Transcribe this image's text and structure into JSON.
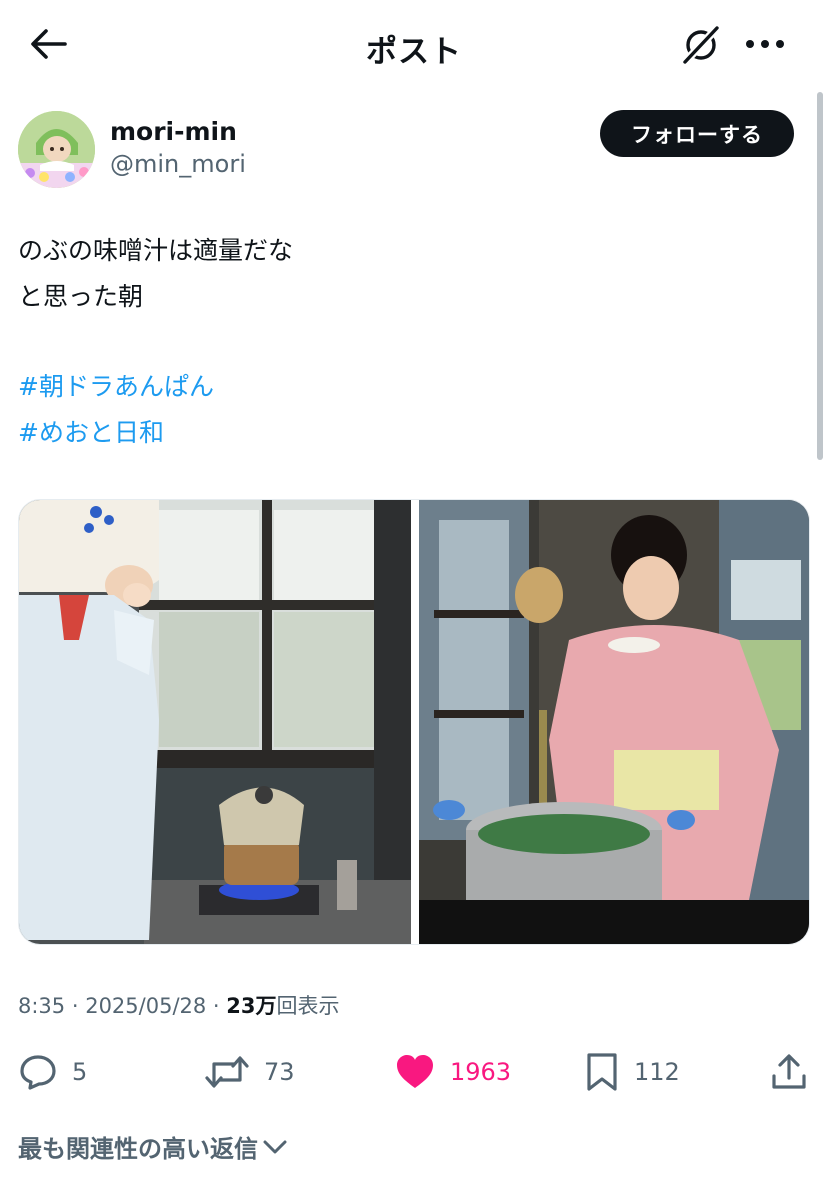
{
  "header": {
    "title": "ポスト"
  },
  "author": {
    "display_name": "mori-min",
    "handle": "@min_mori",
    "follow_label": "フォローする"
  },
  "tweet": {
    "lines": [
      "のぶの味噌汁は適量だな",
      "と思った朝"
    ],
    "hashtags": [
      "#朝ドラあんぱん",
      "#めおと日和"
    ]
  },
  "media": [
    {
      "icon": "photo-woman-drinking-by-stove"
    },
    {
      "icon": "photo-woman-kimono-with-pot"
    }
  ],
  "meta": {
    "time": "8:35",
    "separator1": " · ",
    "date": "2025/05/28",
    "separator2": " · ",
    "views_count": "23万",
    "views_label": "回表示"
  },
  "actions": {
    "replies": "5",
    "reposts": "73",
    "likes": "1963",
    "bookmarks": "112"
  },
  "replies_sort": {
    "label": "最も関連性の高い返信"
  },
  "colors": {
    "accent": "#1d9bf0",
    "like": "#f91880",
    "text": "#0f1419",
    "secondary": "#536471"
  }
}
